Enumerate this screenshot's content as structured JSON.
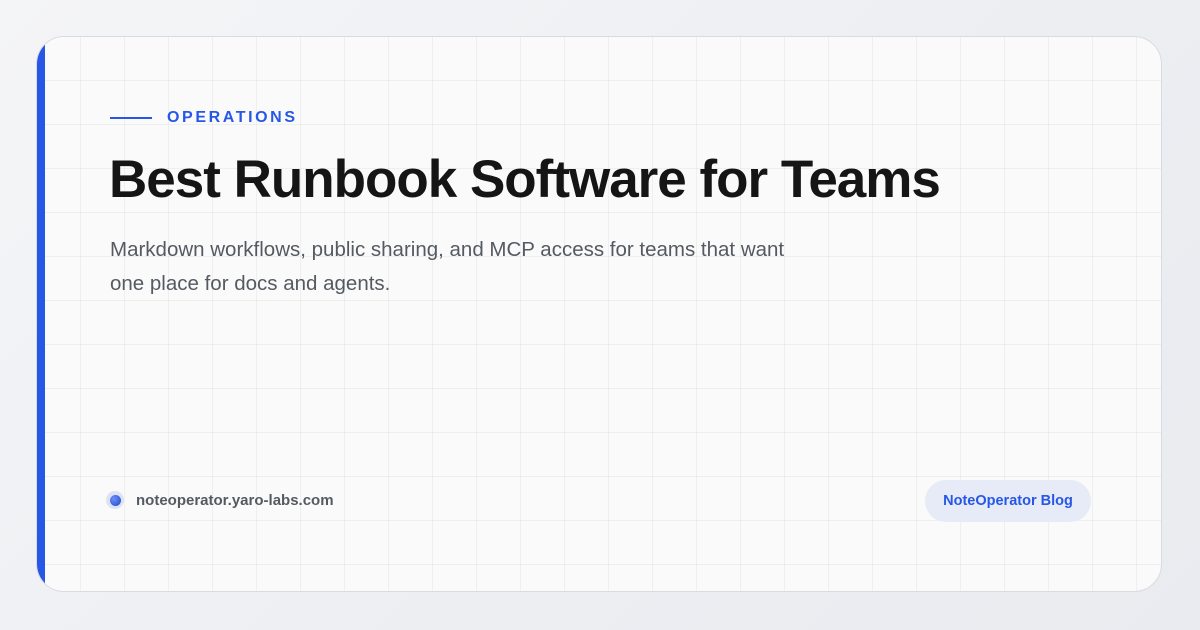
{
  "card": {
    "category": "OPERATIONS",
    "title": "Best Runbook Software for Teams",
    "subtitle": "Markdown workflows, public sharing, and MCP access for teams that want one place for docs and agents."
  },
  "footer": {
    "site_icon": "globe-dot-icon",
    "site_url": "noteoperator.yaro-labs.com",
    "badge_label": "NoteOperator Blog"
  },
  "colors": {
    "accent": "#2657e6",
    "title": "#151515",
    "muted_text": "#555a62",
    "badge_background": "#e6ebf7"
  }
}
